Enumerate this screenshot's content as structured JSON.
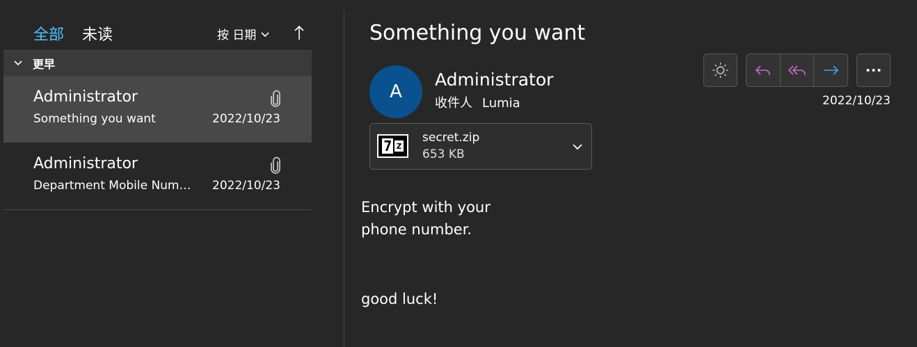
{
  "list": {
    "tabs": [
      {
        "label": "全部",
        "active": true
      },
      {
        "label": "未读",
        "active": false
      }
    ],
    "sort_label": "按 日期",
    "group_label": "更早",
    "items": [
      {
        "sender": "Administrator",
        "subject": "Something you want",
        "date": "2022/10/23",
        "has_attachment": true,
        "selected": true
      },
      {
        "sender": "Administrator",
        "subject": "Department Mobile Number List",
        "date": "2022/10/23",
        "has_attachment": true,
        "selected": false
      }
    ]
  },
  "message": {
    "title": "Something you want",
    "avatar_letter": "A",
    "from": "Administrator",
    "to_label": "收件人",
    "to_name": "Lumia",
    "date": "2022/10/23",
    "attachment": {
      "name": "secret.zip",
      "size": "653 KB",
      "icon": "7z-icon"
    },
    "body": {
      "line1": "Encrypt with your",
      "line2": "phone number.",
      "line3": "good luck!"
    }
  },
  "colors": {
    "background": "#272727",
    "accent": "#4cc2ff",
    "avatar": "#0a5190",
    "reply_icons": "#c86ad4",
    "forward_icon": "#4c9dde"
  }
}
